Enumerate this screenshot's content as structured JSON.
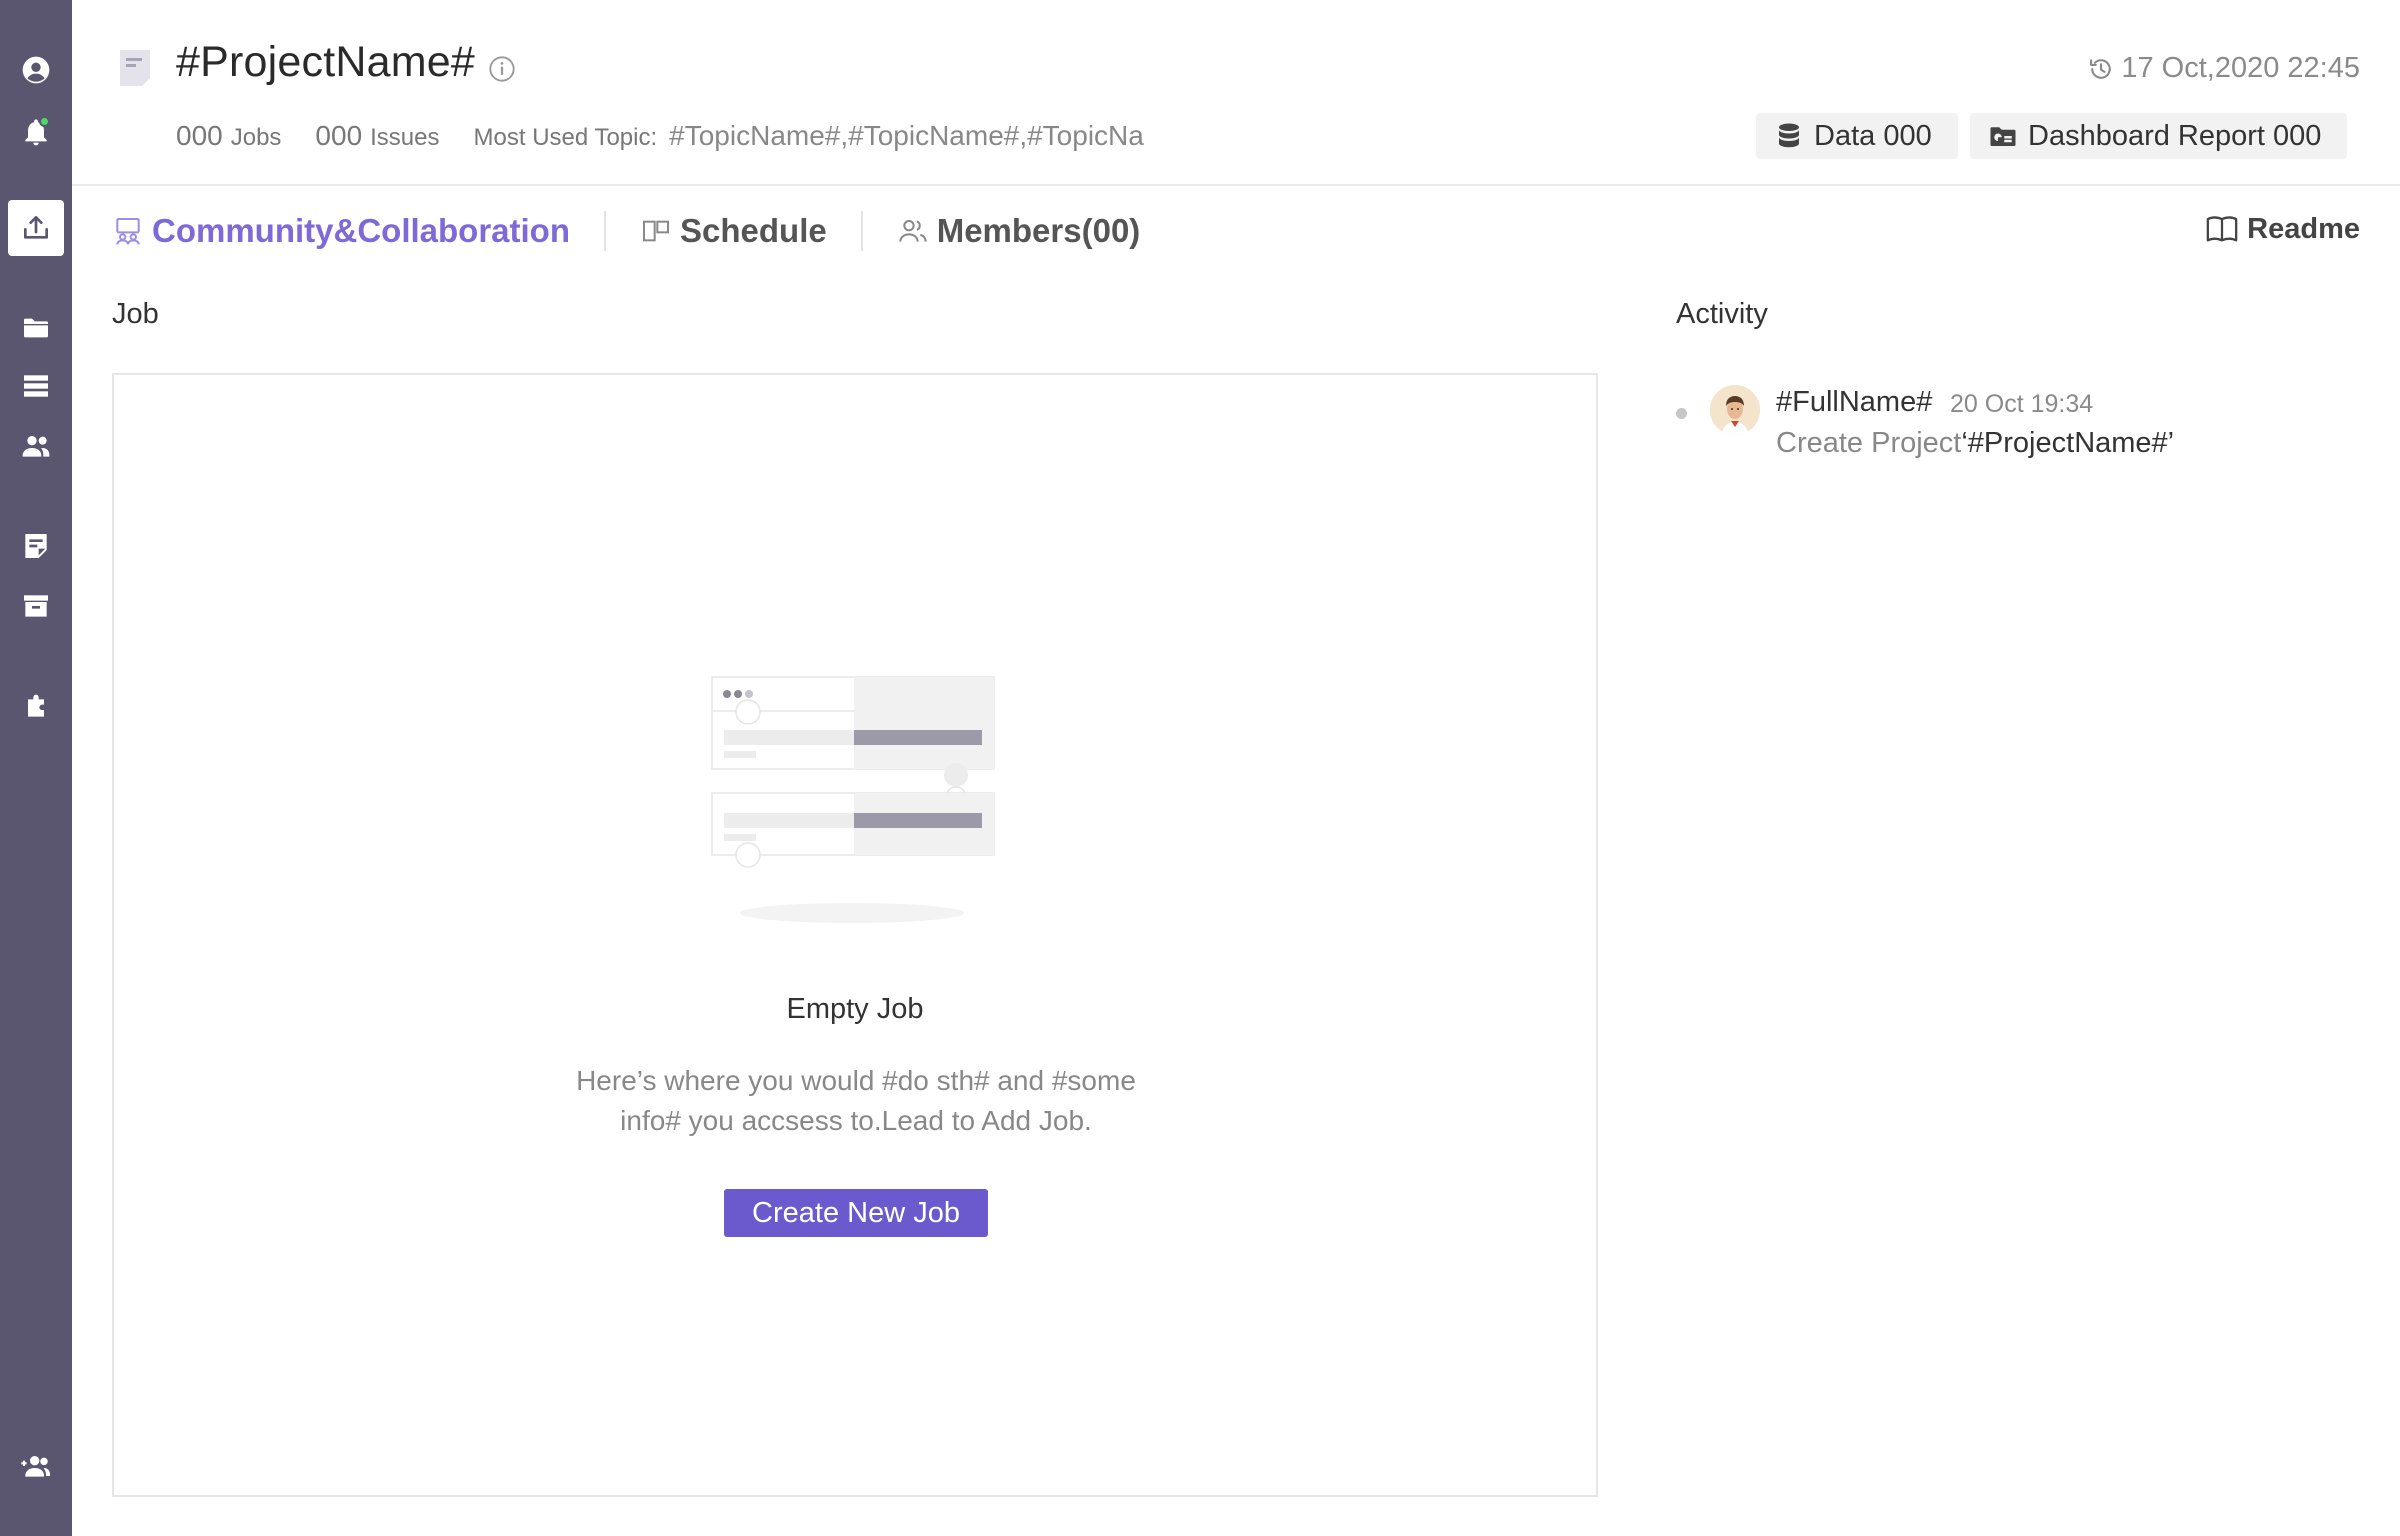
{
  "sidebar": {
    "items": [
      {
        "icon": "user-circle-icon"
      },
      {
        "icon": "bell-icon",
        "notification": true
      },
      {
        "icon": "upload-icon",
        "active": true
      },
      {
        "icon": "folder-icon"
      },
      {
        "icon": "list-icon"
      },
      {
        "icon": "users-icon"
      },
      {
        "icon": "note-icon"
      },
      {
        "icon": "archive-icon"
      },
      {
        "icon": "puzzle-icon"
      },
      {
        "icon": "add-user-icon"
      }
    ]
  },
  "header": {
    "title": "#ProjectName#",
    "timestamp": "17 Oct,2020 22:45",
    "jobs_count": "000",
    "jobs_label": "Jobs",
    "issues_count": "000",
    "issues_label": "Issues",
    "topic_label": "Most Used Topic:",
    "topic_value": "#TopicName#,#TopicName#,#TopicNa",
    "data_chip": "Data 000",
    "dashboard_chip": "Dashboard Report 000"
  },
  "tabs": [
    {
      "label": "Community&Collaboration",
      "active": true
    },
    {
      "label": "Schedule"
    },
    {
      "label": "Members(00)"
    }
  ],
  "readme_label": "Readme",
  "job": {
    "section_title": "Job",
    "empty_title": "Empty Job",
    "empty_desc_line1": "Here’s where you would #do sth# and #some",
    "empty_desc_line2": "info# you accsess to.Lead to Add Job.",
    "create_button": "Create New Job"
  },
  "activity": {
    "section_title": "Activity",
    "items": [
      {
        "name": "#FullName#",
        "date": "20 Oct  19:34",
        "action": "Create Project",
        "project": "‘#ProjectName#’"
      }
    ]
  },
  "colors": {
    "sidebar_bg": "#5b5670",
    "accent": "#6b5acd",
    "active_tab": "#7e69d8",
    "online_dot": "#4cd964"
  }
}
